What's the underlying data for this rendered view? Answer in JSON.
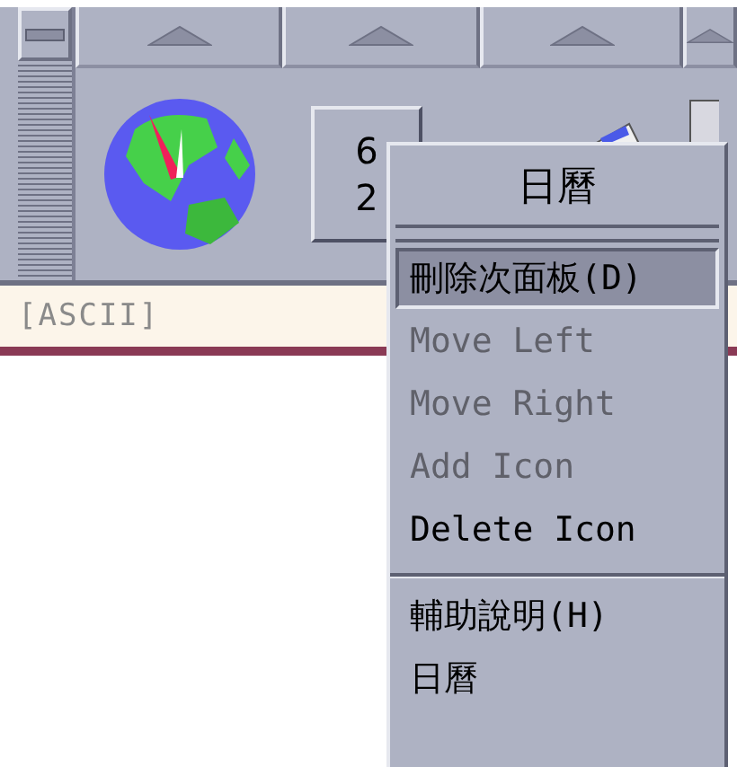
{
  "panel": {
    "controls": [
      {
        "kind": "globe-clock"
      },
      {
        "kind": "calendar",
        "month": "6",
        "day": "2"
      },
      {
        "kind": "palette"
      },
      {
        "kind": "partial"
      }
    ]
  },
  "status_text": "[ASCII]",
  "menu": {
    "title": "日曆",
    "items": [
      {
        "kind": "item",
        "label": "刪除次面板(D)",
        "selected": true,
        "disabled": false
      },
      {
        "kind": "item",
        "label": "Move Left",
        "selected": false,
        "disabled": true
      },
      {
        "kind": "item",
        "label": "Move Right",
        "selected": false,
        "disabled": true
      },
      {
        "kind": "item",
        "label": "Add Icon",
        "selected": false,
        "disabled": true
      },
      {
        "kind": "item",
        "label": "Delete Icon",
        "selected": false,
        "disabled": false
      },
      {
        "kind": "separator"
      },
      {
        "kind": "item",
        "label": "輔助說明(H)",
        "selected": false,
        "disabled": false
      },
      {
        "kind": "item",
        "label": "日曆",
        "selected": false,
        "disabled": false
      }
    ]
  }
}
